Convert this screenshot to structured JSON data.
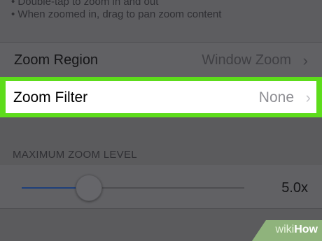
{
  "notes": {
    "line1": "• Double-tap to zoom in and out",
    "line2": "• When zoomed in, drag to pan zoom content"
  },
  "zoom_region": {
    "label": "Zoom Region",
    "value": "Window Zoom",
    "chevron_icon": "chevron-right-icon"
  },
  "zoom_filter": {
    "label": "Zoom Filter",
    "value": "None",
    "chevron_icon": "chevron-right-icon",
    "highlight_color": "#5ddc1b"
  },
  "max_zoom": {
    "header": "MAXIMUM ZOOM LEVEL",
    "value": "5.0x",
    "slider_fraction": 0.27,
    "track_fill_color": "#1e3f7a"
  },
  "watermark": {
    "prefix": "wiki",
    "brand": "How"
  }
}
